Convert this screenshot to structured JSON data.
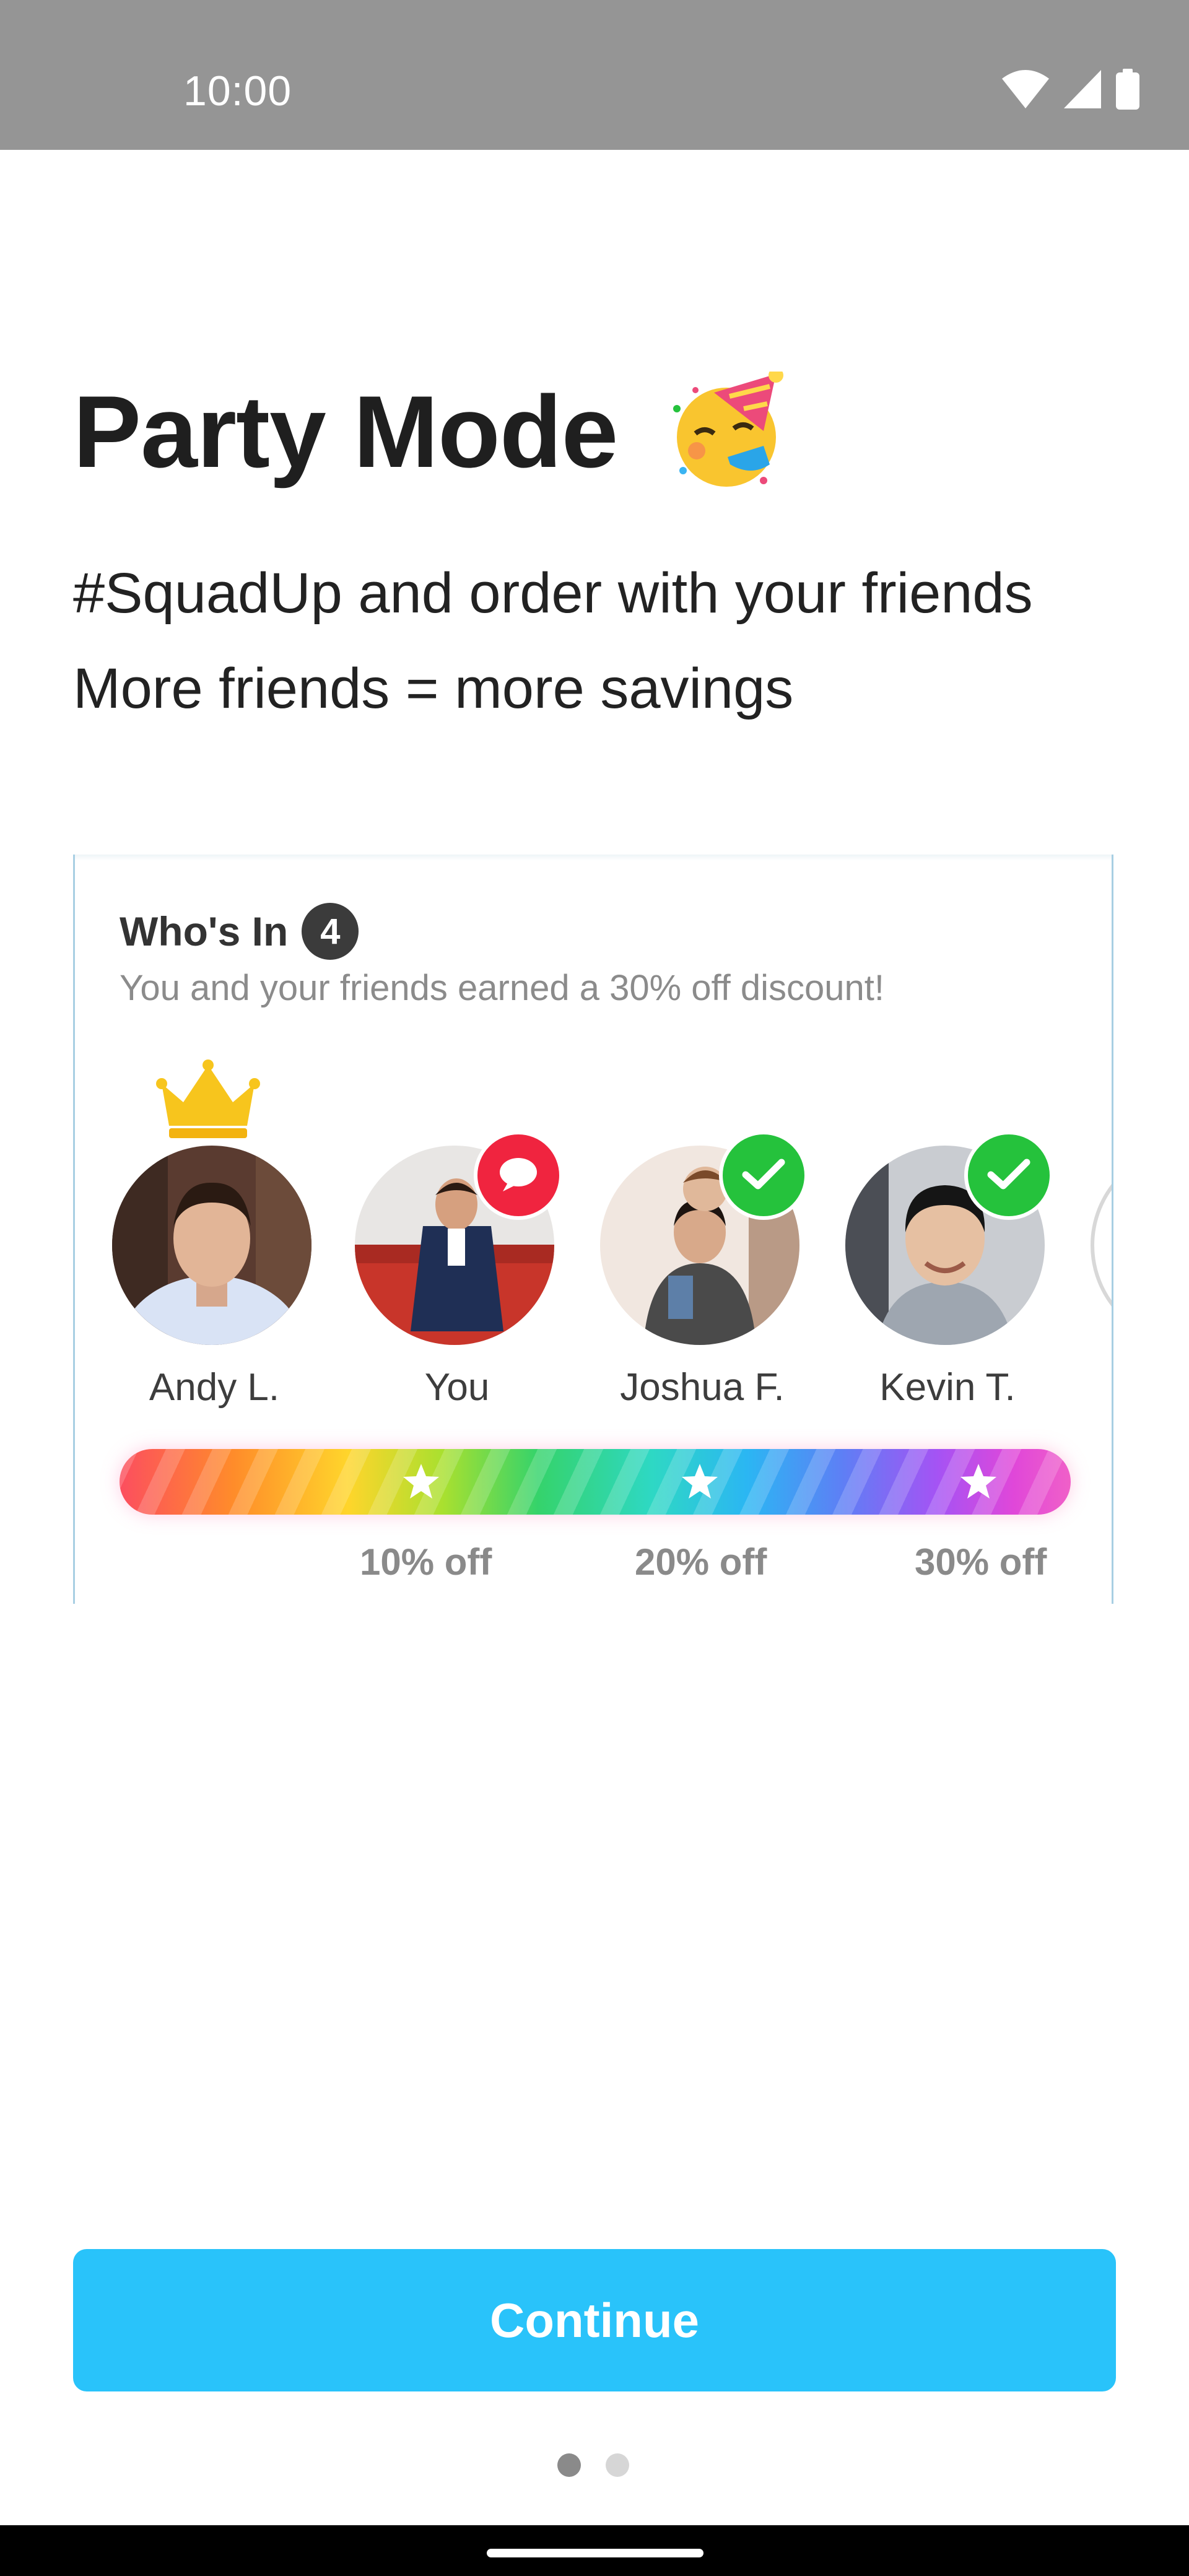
{
  "status_bar": {
    "time": "10:00",
    "icons": [
      "wifi-icon",
      "signal-icon",
      "battery-icon"
    ]
  },
  "page": {
    "title": "Party Mode",
    "title_emoji": "party-face-emoji",
    "subtitle_line1": "#SquadUp and order with your friends",
    "subtitle_line2": "More friends = more savings"
  },
  "preview": {
    "heading": "Who's In",
    "count": "4",
    "earned_text": "You and your friends earned a 30% off discount!",
    "friends": [
      {
        "name": "Andy L.",
        "badge": "crown-icon"
      },
      {
        "name": "You",
        "badge": "chat-bubble-icon"
      },
      {
        "name": "Joshua F.",
        "badge": "check-icon"
      },
      {
        "name": "Kevin T.",
        "badge": "check-icon"
      }
    ],
    "tiers": [
      {
        "label": "10% off"
      },
      {
        "label": "20% off"
      },
      {
        "label": "30% off"
      }
    ],
    "progress_fraction": 1.0
  },
  "actions": {
    "continue_label": "Continue"
  },
  "pager": {
    "current_page": 1,
    "total_pages": 2
  },
  "colors": {
    "accent": "#29c3fa",
    "badge_red": "#f0243f",
    "badge_green": "#25c23c",
    "crown": "#f7c51d"
  }
}
